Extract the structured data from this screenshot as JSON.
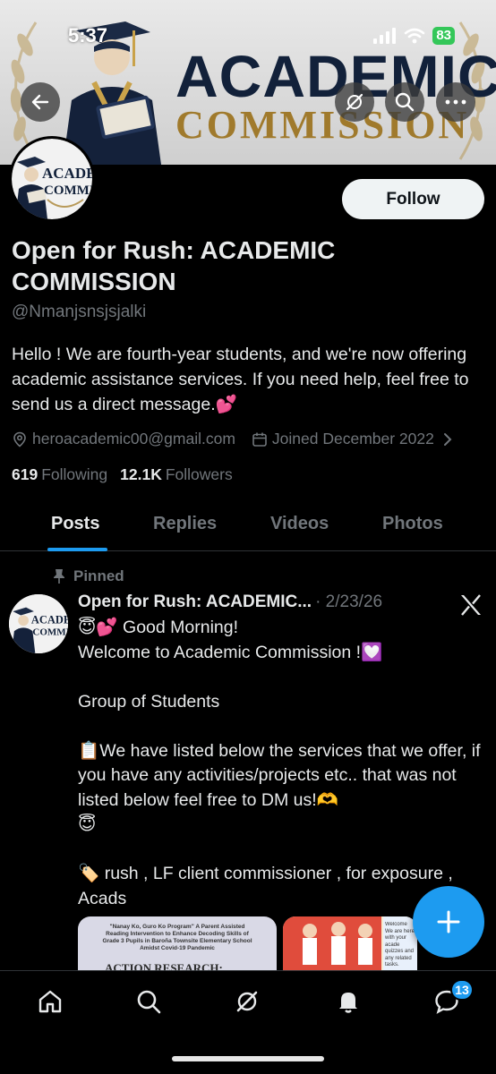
{
  "status_bar": {
    "time": "5:37",
    "battery": "83"
  },
  "banner": {
    "title_line1": "ACADEMIC",
    "title_line2": "COMMISSION"
  },
  "profile": {
    "follow_label": "Follow",
    "name": "Open for Rush: ACADEMIC COMMISSION",
    "handle": "@Nmanjsnsjsjalki",
    "bio": "Hello ! We are fourth-year students, and we're now offering academic assistance services. If you need help, feel free to send us a direct message.💕",
    "email": "heroacademic00@gmail.com",
    "joined": "Joined December 2022",
    "following_count": "619",
    "following_label": "Following",
    "followers_count": "12.1K",
    "followers_label": "Followers"
  },
  "tabs": [
    "Posts",
    "Replies",
    "Videos",
    "Photos"
  ],
  "post": {
    "pinned_label": "Pinned",
    "author": "Open for Rush: ACADEMIC...",
    "date": "· 2/23/26",
    "lines": [
      "😇💕 Good Morning!",
      "Welcome to  Academic Commission !💟",
      "",
      "Group of Students",
      "",
      "📋We have listed below the services that we offer, if you have any activities/projects etc.. that was not listed below feel free to DM us!🫶",
      "😇",
      "",
      "🏷️ rush , LF client commissioner , for exposure , Acads"
    ],
    "media1_caption": "\"Nanay Ko, Guro Ko Program\" A Parent Assisted Reading Intervention to Enhance Decoding Skills of Grade 3 Pupils in Baroña Townsite Elementary School Amidst Covid-19 Pandemic",
    "media1_heading": "ACTION RESEARCH:",
    "media2_text": "Welcome We are here with your acade quizzes and any related tasks."
  },
  "nav": {
    "messages_badge": "13"
  },
  "colors": {
    "accent": "#1d9bf0",
    "background": "#000000",
    "muted": "#71767b"
  }
}
